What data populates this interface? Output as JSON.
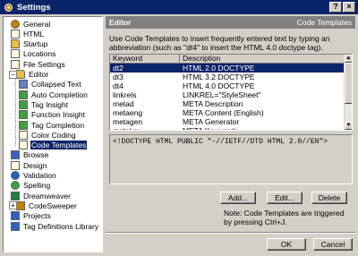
{
  "window": {
    "title": "Settings",
    "controls": {
      "help": "?",
      "close": "×"
    }
  },
  "tree": {
    "items": [
      {
        "label": "General",
        "icon": "gear-icon",
        "level": 0,
        "color": "#c08000"
      },
      {
        "label": "HTML",
        "icon": "document-icon",
        "level": 0,
        "color": "#fffbe0"
      },
      {
        "label": "Startup",
        "icon": "folder-icon",
        "level": 0,
        "color": "#e8c040"
      },
      {
        "label": "Locations",
        "icon": "document-icon",
        "level": 0,
        "color": "#fffbe0"
      },
      {
        "label": "File Settings",
        "icon": "document-icon",
        "level": 0,
        "color": "#fffbe0"
      },
      {
        "label": "Editor",
        "icon": "folder-icon",
        "level": 0,
        "color": "#e8c040",
        "expanded": true
      },
      {
        "label": "Collapsed Text",
        "icon": "collapsed-text-icon",
        "level": 1,
        "color": "#6080c0"
      },
      {
        "label": "Auto Completion",
        "icon": "auto-completion-icon",
        "level": 1,
        "color": "#40a040"
      },
      {
        "label": "Tag Insight",
        "icon": "tag-insight-icon",
        "level": 1,
        "color": "#40a040"
      },
      {
        "label": "Function Insight",
        "icon": "function-insight-icon",
        "level": 1,
        "color": "#40a040"
      },
      {
        "label": "Tag Completion",
        "icon": "tag-completion-icon",
        "level": 1,
        "color": "#40a040"
      },
      {
        "label": "Color Coding",
        "icon": "document-icon",
        "level": 1,
        "color": "#fffbe0"
      },
      {
        "label": "Code Templates",
        "icon": "document-icon",
        "level": 1,
        "color": "#fffbe0",
        "selected": true
      },
      {
        "label": "Browse",
        "icon": "browse-icon",
        "level": 0,
        "color": "#4060c0"
      },
      {
        "label": "Design",
        "icon": "document-icon",
        "level": 0,
        "color": "#fffbe0"
      },
      {
        "label": "Validation",
        "icon": "validation-icon",
        "level": 0,
        "color": "#2060c0"
      },
      {
        "label": "Spelling",
        "icon": "spelling-icon",
        "level": 0,
        "color": "#40a040"
      },
      {
        "label": "Dreamweaver",
        "icon": "dreamweaver-icon",
        "level": 0,
        "color": "#208040"
      },
      {
        "label": "CodeSweeper",
        "icon": "codesweeper-icon",
        "level": 0,
        "color": "#c08000",
        "collapsed": true
      },
      {
        "label": "Projects",
        "icon": "projects-icon",
        "level": 0,
        "color": "#3060c0"
      },
      {
        "label": "Tag Definitions Library",
        "icon": "library-icon",
        "level": 0,
        "color": "#3060c0"
      }
    ]
  },
  "panel": {
    "title": "Editor",
    "subtitle": "Code Templates",
    "description": "Use Code Templates to insert frequently entered text by typing an abbreviation (such as \"dt4\" to insert the HTML 4.0 doctype tag).",
    "columns": {
      "keyword": "Keyword",
      "description": "Description"
    },
    "rows": [
      {
        "keyword": "dt2",
        "description": "HTML 2.0 DOCTYPE",
        "selected": true
      },
      {
        "keyword": "dt3",
        "description": "HTML 3.2 DOCTYPE"
      },
      {
        "keyword": "dt4",
        "description": "HTML 4.0 DOCTYPE"
      },
      {
        "keyword": "linkrels",
        "description": "LINKREL=\"StyleSheet\""
      },
      {
        "keyword": "metad",
        "description": "META Description"
      },
      {
        "keyword": "metaeng",
        "description": "META Content (English)"
      },
      {
        "keyword": "metagen",
        "description": "META Generator"
      },
      {
        "keyword": "metakey",
        "description": "META Keywords"
      }
    ],
    "code": "<!DOCTYPE HTML PUBLIC  \"-//IETF//DTD HTML 2.0//EN\">",
    "buttons": {
      "add": "Add...",
      "edit": "Edit...",
      "delete": "Delete"
    },
    "note": "Note: Code Templates are triggered by pressing Ctrl+J."
  },
  "footer": {
    "ok": "OK",
    "cancel": "Cancel"
  }
}
